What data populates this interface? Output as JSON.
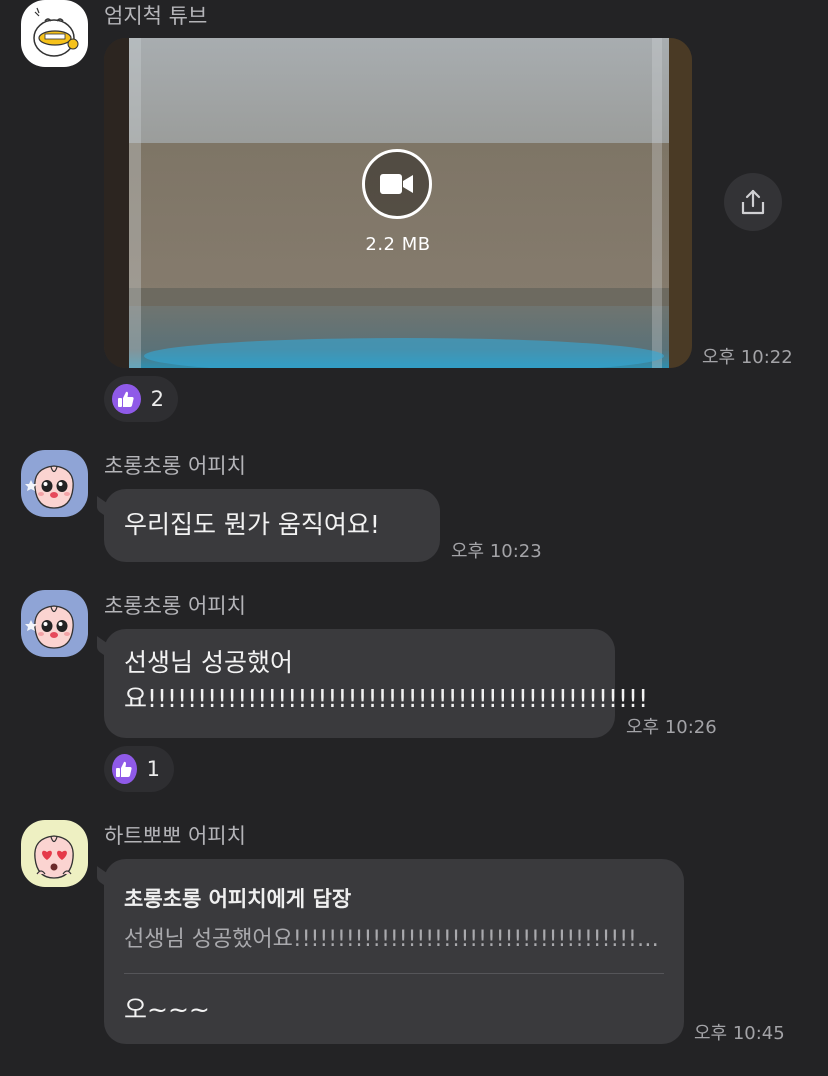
{
  "messages": [
    {
      "sender": "엄지척 튜브",
      "type": "video",
      "video_size": "2.2 MB",
      "time": "오후 10:22",
      "reaction": {
        "icon": "thumbs-up-icon",
        "count": "2"
      }
    },
    {
      "sender": "초롱초롱 어피치",
      "type": "text",
      "text": "우리집도 뭔가 움직여요!",
      "time": "오후 10:23"
    },
    {
      "sender": "초롱초롱 어피치",
      "type": "text",
      "text": "선생님 성공했어요!!!!!!!!!!!!!!!!!!!!!!!!!!!!!!!!!!!!!!!!!!!!!!!!!!",
      "time": "오후 10:26",
      "reaction": {
        "icon": "thumbs-up-icon",
        "count": "1"
      }
    },
    {
      "sender": "하트뽀뽀 어피치",
      "type": "reply",
      "reply_to": "초롱초롱 어피치에게 답장",
      "quote": "선생님 성공했어요!!!!!!!!!!!!!!!!!!!!!!!!!!!!!!!!!!!!!!!!...",
      "text": "오~~~",
      "time": "오후 10:45"
    }
  ],
  "colors": {
    "background": "#232325",
    "bubble": "#3a3a3d",
    "like_accent": "#8f5ae8"
  }
}
